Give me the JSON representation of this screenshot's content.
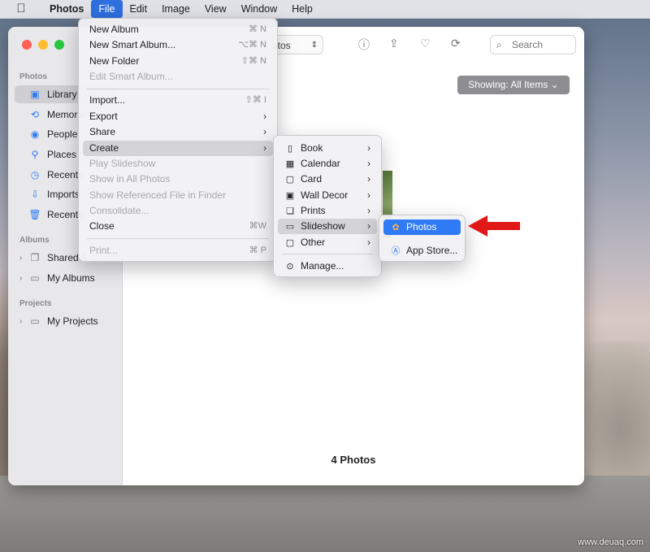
{
  "menubar": {
    "apple_icon": "apple-logo-icon",
    "items": [
      "Photos",
      "File",
      "Edit",
      "Image",
      "View",
      "Window",
      "Help"
    ]
  },
  "window": {
    "view_select": "otos",
    "search_placeholder": "Search",
    "showing_label": "Showing: All Items",
    "photo_count": "4 Photos"
  },
  "sidebar": {
    "section_photos": "Photos",
    "items": [
      {
        "label": "Library",
        "icon": "library-icon"
      },
      {
        "label": "Memorie",
        "icon": "memories-icon"
      },
      {
        "label": "People",
        "icon": "people-icon"
      },
      {
        "label": "Places",
        "icon": "places-icon"
      },
      {
        "label": "Recents",
        "icon": "recents-icon"
      },
      {
        "label": "Imports",
        "icon": "imports-icon"
      },
      {
        "label": "Recently",
        "icon": "trash-icon"
      }
    ],
    "section_albums": "Albums",
    "albums": [
      {
        "label": "Shared A",
        "icon": "shared-albums-icon"
      },
      {
        "label": "My Albums",
        "icon": "folder-icon"
      }
    ],
    "section_projects": "Projects",
    "projects": [
      {
        "label": "My Projects",
        "icon": "folder-icon"
      }
    ]
  },
  "file_menu": {
    "new_album": "New Album",
    "new_album_sc": "⌘ N",
    "new_smart_album": "New Smart Album...",
    "new_smart_album_sc": "⌥⌘ N",
    "new_folder": "New Folder",
    "new_folder_sc": "⇧⌘ N",
    "edit_smart_album": "Edit Smart Album...",
    "import": "Import...",
    "import_sc": "⇧⌘ I",
    "export": "Export",
    "share": "Share",
    "create": "Create",
    "play_slideshow": "Play Slideshow",
    "show_in_all_photos": "Show in All Photos",
    "show_referenced": "Show Referenced File in Finder",
    "consolidate": "Consolidate...",
    "close": "Close",
    "close_sc": "⌘W",
    "print": "Print...",
    "print_sc": "⌘ P"
  },
  "create_menu": {
    "book": "Book",
    "calendar": "Calendar",
    "card": "Card",
    "wall_decor": "Wall Decor",
    "prints": "Prints",
    "slideshow": "Slideshow",
    "other": "Other",
    "manage": "Manage..."
  },
  "slideshow_menu": {
    "photos": "Photos",
    "app_store": "App Store..."
  },
  "colors": {
    "highlight": "#2f7bf5",
    "annotation_arrow": "#e01818"
  },
  "watermark": "www.deuaq.com"
}
